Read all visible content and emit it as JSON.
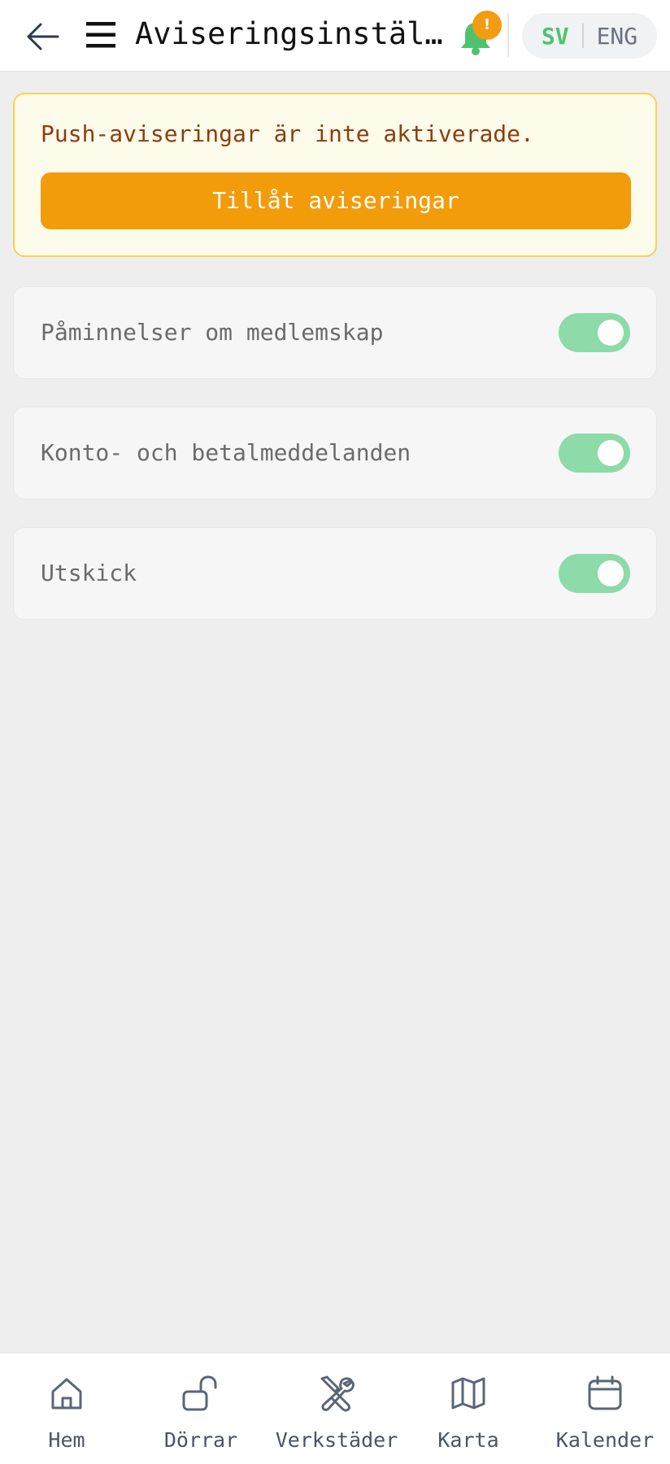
{
  "header": {
    "title": "Aviseringsinställningar",
    "notification_badge": "!",
    "languages": {
      "active": "SV",
      "other": "ENG"
    },
    "icons": {
      "back": "arrow-left-icon",
      "menu": "hamburger-menu-icon",
      "bell": "bell-icon"
    }
  },
  "alert": {
    "message": "Push-aviseringar är inte aktiverade.",
    "button_label": "Tillåt aviseringar"
  },
  "settings": [
    {
      "label": "Påminnelser om medlemskap",
      "enabled": true
    },
    {
      "label": "Konto- och betalmeddelanden",
      "enabled": true
    },
    {
      "label": "Utskick",
      "enabled": true
    }
  ],
  "bottom_nav": [
    {
      "label": "Hem",
      "icon": "home-icon"
    },
    {
      "label": "Dörrar",
      "icon": "unlock-icon"
    },
    {
      "label": "Verkstäder",
      "icon": "tools-icon"
    },
    {
      "label": "Karta",
      "icon": "map-icon"
    },
    {
      "label": "Kalender",
      "icon": "calendar-icon"
    }
  ],
  "colors": {
    "accent_green": "#4fc26e",
    "toggle_on": "#8ddba8",
    "warning_orange": "#f39c0b",
    "alert_background": "#fdfbea",
    "alert_text": "#8b3d12"
  }
}
